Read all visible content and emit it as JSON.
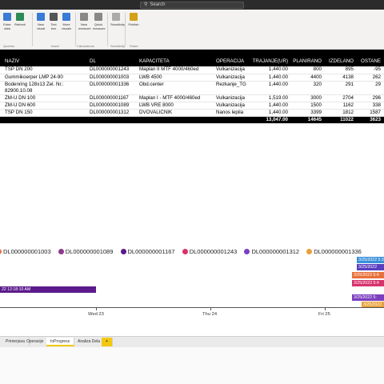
{
  "search": {
    "placeholder": "Search",
    "icon": "search-icon"
  },
  "ribbon": {
    "buttons": [
      {
        "label": "Enter data",
        "icon": "table-icon",
        "color": "#3a7bd5"
      },
      {
        "label": "Dataverse",
        "icon": "dataverse-icon",
        "color": "#6b4fbb"
      },
      {
        "label": "Transform data",
        "icon": "transform-icon",
        "color": "#b48d1a"
      },
      {
        "label": "Refresh",
        "icon": "refresh-icon",
        "color": "#2e8b57"
      },
      {
        "label": "New visual",
        "icon": "chart-icon",
        "color": "#3a7bd5"
      },
      {
        "label": "Text box",
        "icon": "textbox-icon",
        "color": "#555555"
      },
      {
        "label": "More visuals",
        "icon": "more-visuals-icon",
        "color": "#3a7bd5"
      },
      {
        "label": "New measure",
        "icon": "calculator-icon",
        "color": "#888888"
      },
      {
        "label": "Quick measure",
        "icon": "quick-measure-icon",
        "color": "#888888"
      },
      {
        "label": "Sensitivity",
        "icon": "shield-icon",
        "color": "#aaaaaa"
      },
      {
        "label": "Publish",
        "icon": "publish-icon",
        "color": "#d4a017"
      }
    ],
    "groups": [
      "Queries",
      "Insert",
      "Calculations",
      "Sensitivity",
      "Share"
    ]
  },
  "table": {
    "columns": [
      "NAZIV",
      "DL",
      "KAPACITETA",
      "OPERACIJA",
      "TRAJANJE(UR)",
      "PLANIRANO",
      "IZDELANO",
      "OSTANE"
    ],
    "rows": [
      [
        "TSP DN 200",
        "DL000000001243",
        "Maplan II MTF 4000/460ed",
        "Vulkanizacija",
        "1,440.00",
        "800",
        "895",
        "-95"
      ],
      [
        "Gummikoerper LMP 24-90",
        "DL000000001003",
        "LWB 4500",
        "Vulkanizacija",
        "1,440.00",
        "4400",
        "4138",
        "262"
      ],
      [
        "Bodenring 128x13 Zel. Nr.: 82900.10.08",
        "DL000000001336",
        "Obd.center",
        "Rezkanje_TG",
        "1,440.00",
        "320",
        "291",
        "29"
      ],
      [
        "ZM-U DN 100",
        "DL000000001167",
        "Maplan I - MTF 4000/460ed",
        "Vulkanizacija",
        "1,519.00",
        "3000",
        "2704",
        "296"
      ],
      [
        "ZM-U DN 600",
        "DL000000001089",
        "LWB VRE 8000",
        "Vulkanizacija",
        "1,440.00",
        "1500",
        "1162",
        "338"
      ],
      [
        "TSP DN 150",
        "DL000000001312",
        "DVOVALIČNIK",
        "Nanos lepila",
        "1,440.00",
        "3399",
        "1812",
        "1587"
      ]
    ],
    "total": [
      "",
      "",
      "",
      "",
      "13,047.00",
      "14645",
      "11022",
      "3623"
    ]
  },
  "timeline": {
    "legend": [
      {
        "label": "DL000000001003",
        "color": "#e8703a"
      },
      {
        "label": "DL000000001089",
        "color": "#8b3a8b"
      },
      {
        "label": "DL000000001167",
        "color": "#5c1a8c"
      },
      {
        "label": "DL000000001243",
        "color": "#d6336c"
      },
      {
        "label": "DL000000001312",
        "color": "#7b3fbf"
      },
      {
        "label": "DL000000001336",
        "color": "#e8a13a"
      }
    ],
    "axis_ticks": [
      "Wed 23",
      "Thu 24",
      "Fri 25"
    ],
    "bars": [
      {
        "label": "3/25/2022 5:3",
        "color": "#3b8fd9"
      },
      {
        "label": "3/25/2022",
        "color": "#5a3fc0"
      },
      {
        "label": "3/25/2022 5:4",
        "color": "#e8703a"
      },
      {
        "label": "3/25/2022 5:4",
        "color": "#d6336c"
      },
      {
        "label": "22 12:18:10 AM",
        "color": "#5c1a8c"
      },
      {
        "label": "3/25/2022 5:",
        "color": "#7b3fbf"
      },
      {
        "label": "3/25/2022",
        "color": "#e8a13a"
      }
    ]
  },
  "tabs": [
    {
      "label": "Primerjava",
      "active": false
    },
    {
      "label": "Operacije",
      "active": false
    },
    {
      "label": "InProgress",
      "active": true
    },
    {
      "label": "Analiza Dela",
      "active": false
    },
    {
      "label": "+",
      "active": false
    }
  ]
}
